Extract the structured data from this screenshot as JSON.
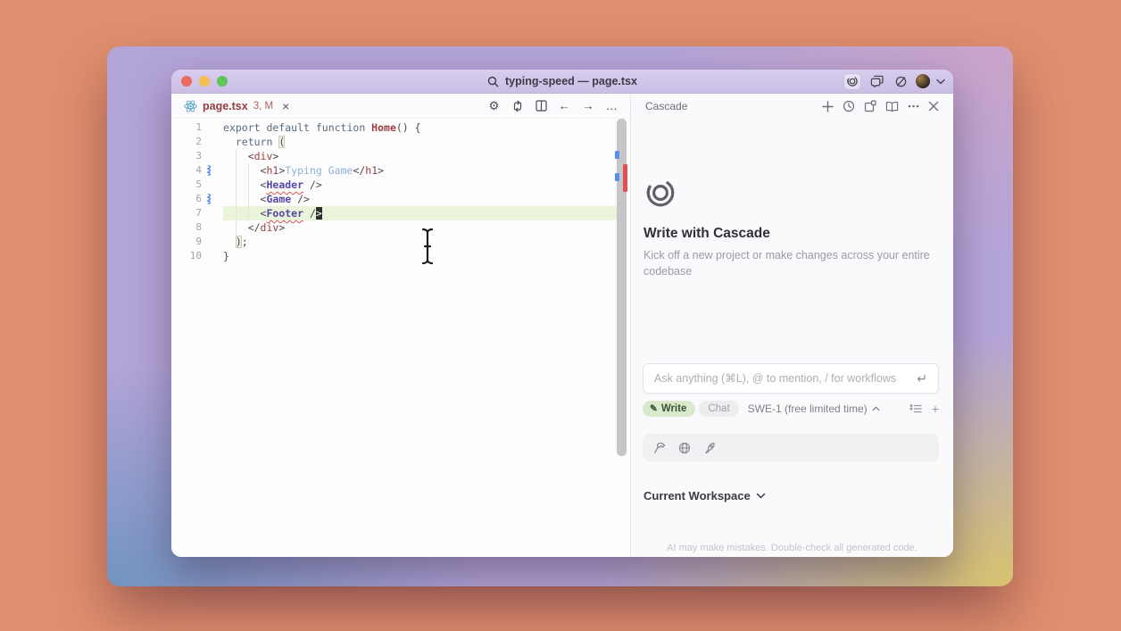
{
  "titlebar": {
    "title": "typing-speed — page.tsx"
  },
  "tabbar": {
    "tab": {
      "name": "page.tsx",
      "badge": "3, M",
      "close_label": "×"
    },
    "toolbar": {
      "gear": "⚙",
      "back": "←",
      "forward": "→",
      "more": "…"
    }
  },
  "editor": {
    "lines": [
      {
        "n": 1,
        "mod": false,
        "hl": false,
        "seg": [
          {
            "t": "export default function ",
            "c": "kw"
          },
          {
            "t": "Home",
            "c": "fn"
          },
          {
            "t": "() {",
            "c": "pl"
          }
        ]
      },
      {
        "n": 2,
        "mod": false,
        "hl": false,
        "seg": [
          {
            "t": "  ",
            "c": "pl"
          },
          {
            "t": "return",
            "c": "kw"
          },
          {
            "t": " ",
            "c": "pl"
          },
          {
            "t": "(",
            "c": "match"
          }
        ]
      },
      {
        "n": 3,
        "mod": false,
        "hl": false,
        "seg": [
          {
            "t": "    <",
            "c": "pl"
          },
          {
            "t": "div",
            "c": "tag"
          },
          {
            "t": ">",
            "c": "pl"
          }
        ]
      },
      {
        "n": 4,
        "mod": true,
        "hl": false,
        "seg": [
          {
            "t": "      <",
            "c": "pl"
          },
          {
            "t": "h1",
            "c": "tag"
          },
          {
            "t": ">",
            "c": "pl"
          },
          {
            "t": "Typing Game",
            "c": "txt"
          },
          {
            "t": "</",
            "c": "pl"
          },
          {
            "t": "h1",
            "c": "tag"
          },
          {
            "t": ">",
            "c": "pl"
          }
        ]
      },
      {
        "n": 5,
        "mod": false,
        "hl": false,
        "seg": [
          {
            "t": "      <",
            "c": "pl"
          },
          {
            "t": "Header",
            "c": "cmp"
          },
          {
            "t": " />",
            "c": "pl"
          }
        ]
      },
      {
        "n": 6,
        "mod": true,
        "hl": false,
        "seg": [
          {
            "t": "      <",
            "c": "pl"
          },
          {
            "t": "Game",
            "c": "cmp"
          },
          {
            "t": " />",
            "c": "pl"
          }
        ]
      },
      {
        "n": 7,
        "mod": false,
        "hl": true,
        "seg": [
          {
            "t": "      <",
            "c": "pl"
          },
          {
            "t": "Footer",
            "c": "cmp"
          },
          {
            "t": " /",
            "c": "pl"
          },
          {
            "t": ">",
            "c": "cursor"
          }
        ]
      },
      {
        "n": 8,
        "mod": false,
        "hl": false,
        "seg": [
          {
            "t": "    </",
            "c": "pl"
          },
          {
            "t": "div",
            "c": "tag"
          },
          {
            "t": ">",
            "c": "pl"
          }
        ]
      },
      {
        "n": 9,
        "mod": false,
        "hl": false,
        "seg": [
          {
            "t": "  ",
            "c": "pl"
          },
          {
            "t": ")",
            "c": "match"
          },
          {
            "t": ";",
            "c": "pl"
          }
        ]
      },
      {
        "n": 10,
        "mod": false,
        "hl": false,
        "seg": [
          {
            "t": "}",
            "c": "pl"
          }
        ]
      }
    ]
  },
  "cascade": {
    "header": "Cascade",
    "hero_title": "Write with Cascade",
    "hero_sub": "Kick off a new project or make changes across your entire codebase",
    "input_placeholder": "Ask anything (⌘L), @ to mention, / for workflows",
    "return_glyph": "↵",
    "mode_write": "Write",
    "mode_write_glyph": "✎",
    "mode_chat": "Chat",
    "model": "SWE-1 (free limited time)",
    "plus_glyph": "+",
    "workspace": "Current Workspace",
    "disclaimer": "AI may make mistakes. Double-check all generated code."
  },
  "colors": {
    "accent_green": "#d9e9cc",
    "highlight_line": "#e9f4da",
    "error_red": "#d9534f",
    "modified_blue": "#5b8def",
    "titlebar_lavender": "#cabee5"
  }
}
